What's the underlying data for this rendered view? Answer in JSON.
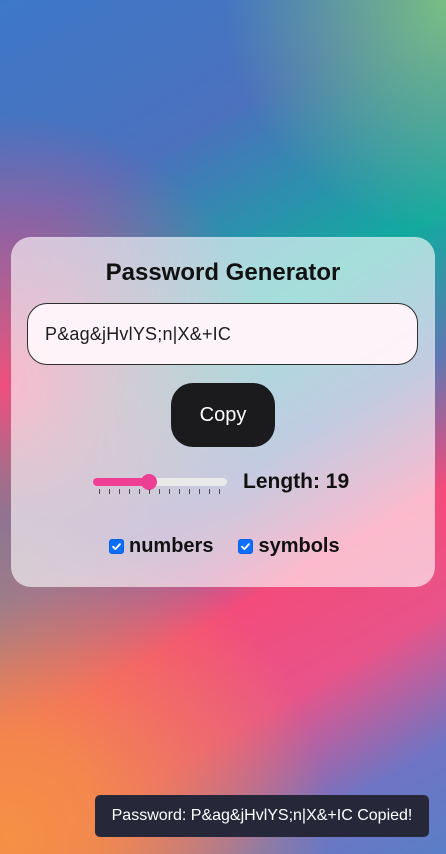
{
  "app": {
    "title": "Password Generator"
  },
  "generator": {
    "password": "P&ag&jHvlYS;n|X&+IC",
    "copy_label": "Copy",
    "length_label": "Length: 19",
    "length_value": 19,
    "length_fill_fraction": 0.42,
    "options": {
      "numbers_label": "numbers",
      "symbols_label": "symbols",
      "numbers_checked": true,
      "symbols_checked": true
    }
  },
  "toast": {
    "message": "Password: P&ag&jHvlYS;n|X&+IC Copied!"
  },
  "colors": {
    "card_background": "#ffffff",
    "button_background": "#1b1b1d",
    "accent_pink": "#ec3f93",
    "checkbox_blue": "#0d6efd",
    "toast_background": "#26283a"
  }
}
